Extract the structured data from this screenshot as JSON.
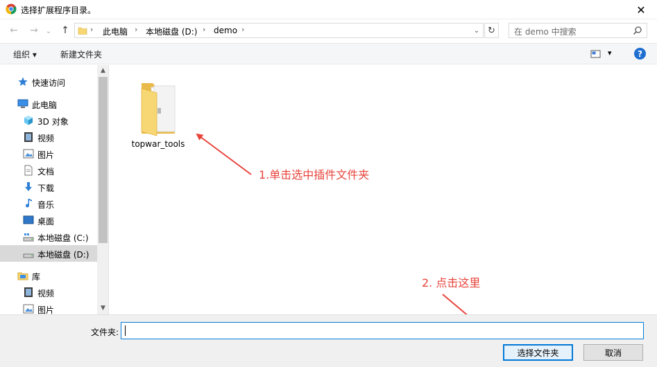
{
  "window": {
    "title": "选择扩展程序目录。",
    "close_glyph": "✕"
  },
  "nav": {
    "back_glyph": "←",
    "forward_glyph": "→",
    "recent_glyph": "⌄",
    "up_glyph": "↑",
    "breadcrumbs": [
      "此电脑",
      "本地磁盘 (D:)",
      "demo"
    ],
    "refresh_glyph": "↻",
    "search_placeholder": "在 demo 中搜索"
  },
  "toolbar": {
    "organize_label": "组织 ▾",
    "new_folder_label": "新建文件夹",
    "view_menu_glyph": "▾",
    "help_label": "?"
  },
  "sidebar": {
    "items": [
      {
        "label": "快速访问",
        "icon": "star-icon",
        "indent": 0
      },
      {
        "label": "此电脑",
        "icon": "computer-icon",
        "indent": 0
      },
      {
        "label": "3D 对象",
        "icon": "cube-icon",
        "indent": 1
      },
      {
        "label": "视频",
        "icon": "film-icon",
        "indent": 1
      },
      {
        "label": "图片",
        "icon": "picture-icon",
        "indent": 1
      },
      {
        "label": "文档",
        "icon": "document-icon",
        "indent": 1
      },
      {
        "label": "下载",
        "icon": "download-icon",
        "indent": 1
      },
      {
        "label": "音乐",
        "icon": "music-icon",
        "indent": 1
      },
      {
        "label": "桌面",
        "icon": "desktop-icon",
        "indent": 1
      },
      {
        "label": "本地磁盘 (C:)",
        "icon": "drive-c-icon",
        "indent": 1
      },
      {
        "label": "本地磁盘 (D:)",
        "icon": "drive-d-icon",
        "indent": 1,
        "selected": true
      },
      {
        "label": "库",
        "icon": "library-icon",
        "indent": 0
      },
      {
        "label": "视频",
        "icon": "film-icon",
        "indent": 1
      },
      {
        "label": "图片",
        "icon": "picture-icon",
        "indent": 1
      }
    ],
    "scroll_up_glyph": "▲",
    "scroll_down_glyph": "▼"
  },
  "content": {
    "folders": [
      {
        "name": "topwar_tools"
      }
    ]
  },
  "annotations": {
    "step1": "1.单击选中插件文件夹",
    "step2": "2. 点击这里",
    "color": "#e8433b"
  },
  "footer": {
    "folder_label": "文件夹:",
    "folder_value": "",
    "select_button": "选择文件夹",
    "cancel_button": "取消"
  },
  "colors": {
    "accent": "#0078d7",
    "folder_yellow": "#f7d774",
    "selected_bg": "#d9d9d9"
  }
}
